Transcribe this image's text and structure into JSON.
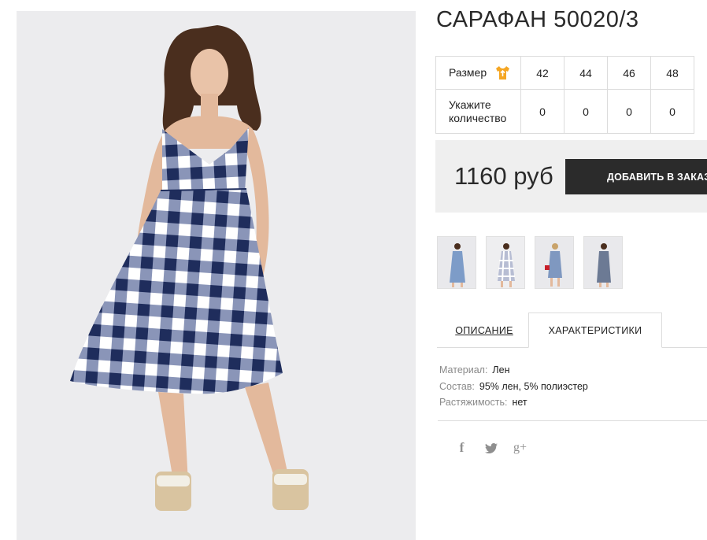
{
  "product": {
    "title": "САРАФАН 50020/3",
    "price": "1160 руб",
    "add_to_cart_label": "ДОБАВИТЬ В ЗАКАЗ"
  },
  "size_table": {
    "size_header": "Размер",
    "size_icon": "tshirt-icon",
    "quantity_header": "Укажите количество",
    "sizes": [
      "42",
      "44",
      "46",
      "48"
    ],
    "quantities": [
      "0",
      "0",
      "0",
      "0"
    ]
  },
  "thumbnails_count": 4,
  "tabs": {
    "description": "ОПИСАНИЕ",
    "characteristics": "ХАРАКТЕРИСТИКИ",
    "active": "characteristics"
  },
  "characteristics": [
    {
      "key": "Материал:",
      "value": "Лен"
    },
    {
      "key": "Состав:",
      "value": "95% лен, 5% полиэстер"
    },
    {
      "key": "Растяжимость:",
      "value": "нет"
    }
  ],
  "social": {
    "facebook": "f",
    "twitter": "twitter-icon",
    "google_plus": "g+"
  },
  "colors": {
    "accent_yellow": "#f5a623",
    "button_dark": "#2b2b2b",
    "dress_navy": "#1f2d5c",
    "dress_light": "#ffffff",
    "dress_mid": "#8a95b8"
  }
}
